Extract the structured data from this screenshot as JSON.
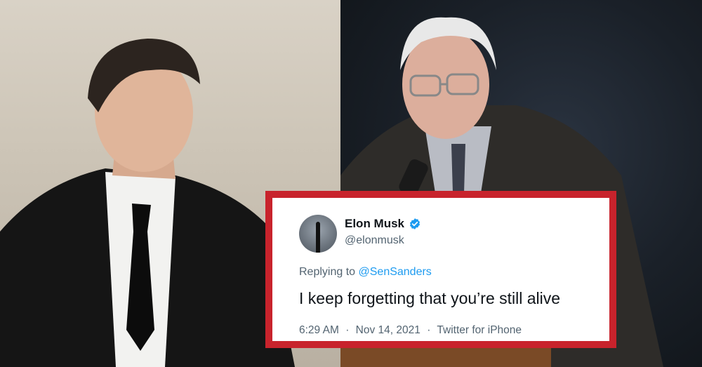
{
  "photos": {
    "left_alt": "Man in dark suit and white shirt",
    "right_alt": "Older man in glasses speaking at microphone"
  },
  "tweet": {
    "display_name": "Elon Musk",
    "handle": "@elonmusk",
    "verified": true,
    "reply_prefix": "Replying to",
    "reply_mention": "@SenSanders",
    "text": "I keep forgetting that you’re still alive",
    "time": "6:29 AM",
    "date": "Nov 14, 2021",
    "source": "Twitter for iPhone",
    "separator": "·"
  },
  "colors": {
    "frame": "#c8232c",
    "verified": "#1d9bf0",
    "mention": "#1d9bf0",
    "secondary_text": "#536471"
  }
}
